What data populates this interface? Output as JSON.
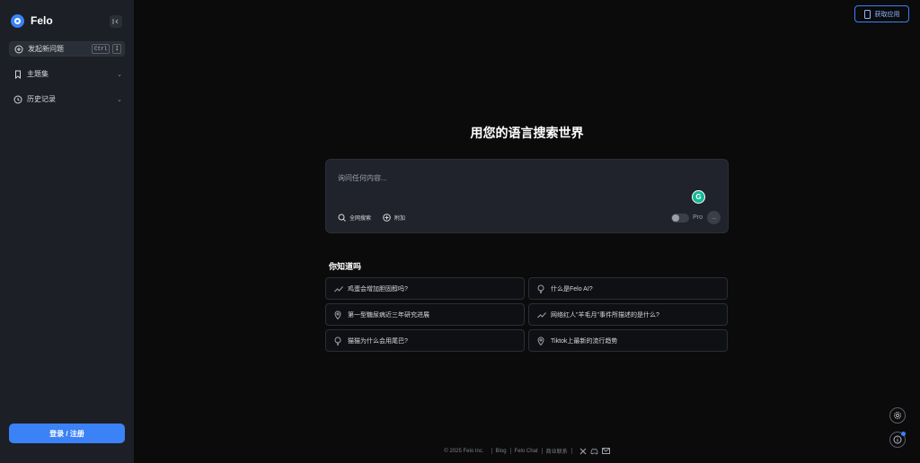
{
  "sidebar": {
    "brand": "Felo",
    "collapse_icon": "collapse-left-icon",
    "new_question": {
      "label": "发起新问题",
      "shortcut": [
        "Ctrl",
        "I"
      ]
    },
    "topics": {
      "label": "主题集"
    },
    "history": {
      "label": "历史记录"
    },
    "login": "登录 / 注册"
  },
  "header": {
    "get_app": "获取应用"
  },
  "main": {
    "headline": "用您的语言搜索世界",
    "search": {
      "placeholder": "询问任何内容...",
      "full_search": "全网搜索",
      "attach": "附加",
      "pro": "Pro"
    },
    "did_you_know": {
      "title": "你知道吗",
      "items": [
        {
          "label": "鸡蛋会增加胆固醇吗?",
          "icon": "trend-icon"
        },
        {
          "label": "什么是Felo AI?",
          "icon": "bulb-icon"
        },
        {
          "label": "第一型糖尿病近三年研究进展",
          "icon": "pin-icon"
        },
        {
          "label": "网络红人\"羊毛月\"事件所描述的是什么?",
          "icon": "trend-icon"
        },
        {
          "label": "猫猫为什么会用尾巴?",
          "icon": "bulb-icon"
        },
        {
          "label": "Tiktok上最新的流行趋势",
          "icon": "pin-icon"
        }
      ]
    }
  },
  "footer": {
    "copyright": "© 2025  Felo Inc.",
    "links": [
      "Blog",
      "Felo Chat",
      "商业联系"
    ]
  },
  "colors": {
    "accent": "#3b82f6",
    "sidebar_bg": "#1c1f25",
    "page_bg": "#0b0b0c"
  }
}
